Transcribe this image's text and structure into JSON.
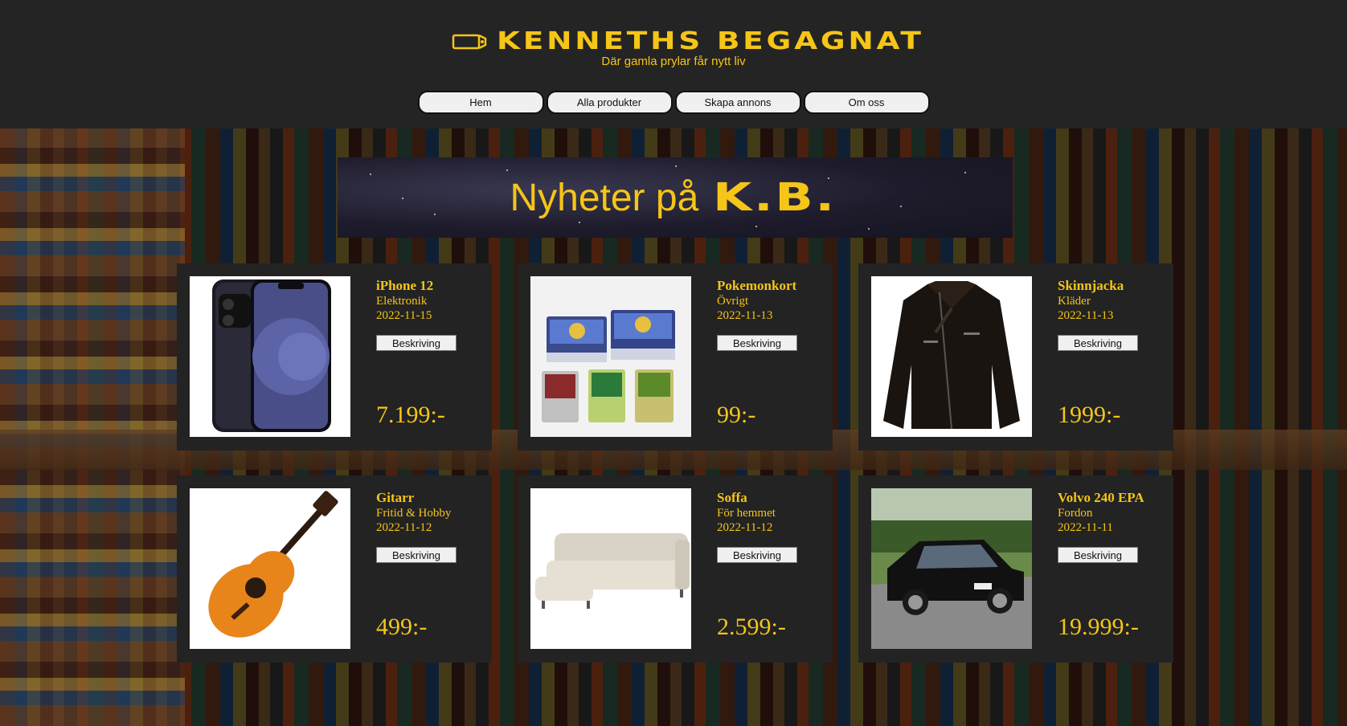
{
  "header": {
    "brand": "KENNETHS BEGAGNAT",
    "tagline": "Där gamla prylar får nytt liv"
  },
  "nav": {
    "items": [
      "Hem",
      "Alla produkter",
      "Skapa annons",
      "Om oss"
    ]
  },
  "banner": {
    "text": "Nyheter på",
    "brand": "K.B."
  },
  "products": [
    {
      "title": "iPhone 12",
      "category": "Elektronik",
      "date": "2022-11-15",
      "button": "Beskriving",
      "price": "7.199:-",
      "image": "phone-image"
    },
    {
      "title": "Pokemonkort",
      "category": "Övrigt",
      "date": "2022-11-13",
      "button": "Beskriving",
      "price": "99:-",
      "image": "cards-image"
    },
    {
      "title": "Skinnjacka",
      "category": "Kläder",
      "date": "2022-11-13",
      "button": "Beskriving",
      "price": "1999:-",
      "image": "jacket-image"
    },
    {
      "title": "Gitarr",
      "category": "Fritid & Hobby",
      "date": "2022-11-12",
      "button": "Beskriving",
      "price": "499:-",
      "image": "guitar-image"
    },
    {
      "title": "Soffa",
      "category": "För hemmet",
      "date": "2022-11-12",
      "button": "Beskriving",
      "price": "2.599:-",
      "image": "sofa-image"
    },
    {
      "title": "Volvo 240 EPA",
      "category": "Fordon",
      "date": "2022-11-11",
      "button": "Beskriving",
      "price": "19.999:-",
      "image": "car-image"
    }
  ],
  "colors": {
    "accent": "#f5c518",
    "header_bg": "#242424",
    "card_bg": "#232323"
  }
}
